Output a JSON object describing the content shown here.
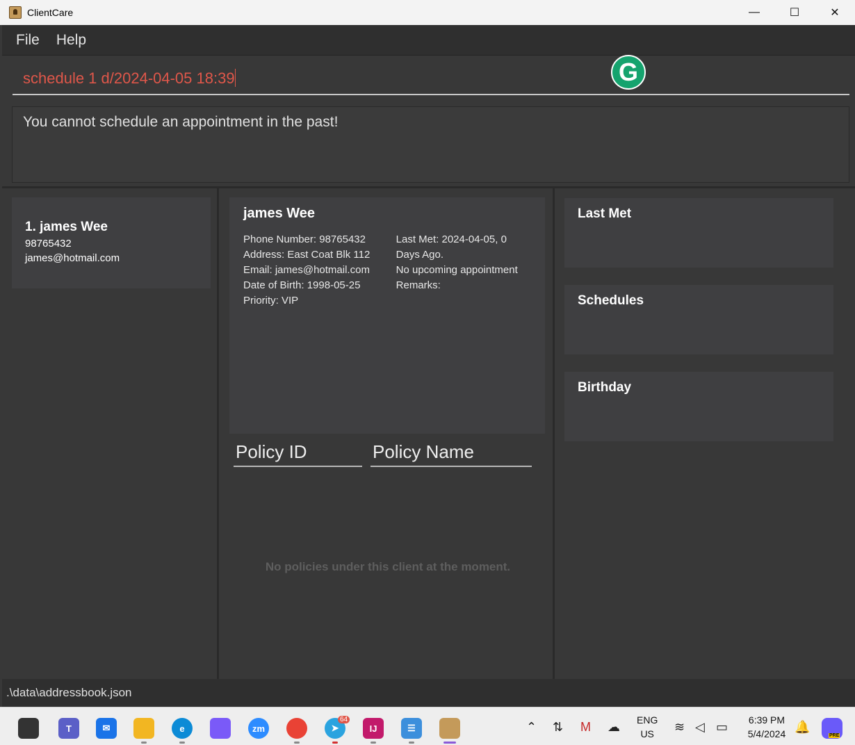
{
  "window": {
    "title": "ClientCare",
    "minimize": "—",
    "maximize": "☐",
    "close": "✕"
  },
  "menu": {
    "file": "File",
    "help": "Help"
  },
  "command": {
    "value": "schedule 1 d/2024-04-05 18:39",
    "grammarly": "G"
  },
  "result": {
    "message": "You cannot schedule an appointment in the past!"
  },
  "clients": [
    {
      "name": "1.  james Wee",
      "phone": "98765432",
      "email": "james@hotmail.com"
    }
  ],
  "detail": {
    "name": "james Wee",
    "left_lines": [
      "Phone Number: 98765432",
      "Address: East Coat Blk 112",
      "Email: james@hotmail.com",
      "Date of Birth: 1998-05-25",
      "Priority: VIP"
    ],
    "right_lines": [
      "Last Met: 2024-04-05, 0",
      "Days Ago.",
      "No upcoming appointment",
      "Remarks:"
    ]
  },
  "policies": {
    "col_id": "Policy ID",
    "col_name": "Policy Name",
    "empty_message": "No policies under this client at the moment."
  },
  "sidebar_boxes": {
    "last_met": "Last Met",
    "schedules": "Schedules",
    "birthday": "Birthday"
  },
  "status": {
    "path": ".\\data\\addressbook.json"
  },
  "taskbar": {
    "telegram_badge": "64",
    "zoom_label": "zm",
    "intellij_label": "IJ",
    "lang_top": "ENG",
    "lang_bottom": "US",
    "time": "6:39 PM",
    "date": "5/4/2024",
    "copilot_badge": "PRE",
    "colors": {
      "teams": "#5b5fc7",
      "mail": "#1a73e8",
      "files": "#f2b622",
      "edge": "#0c8bd6",
      "copilot_app": "#7a5af8",
      "zoom": "#2d8cff",
      "chrome": "#e94235",
      "telegram": "#2aa3df",
      "intellij": "#c21a6b",
      "notepad": "#3c8fdc",
      "clientcare": "#c49a5a"
    }
  }
}
